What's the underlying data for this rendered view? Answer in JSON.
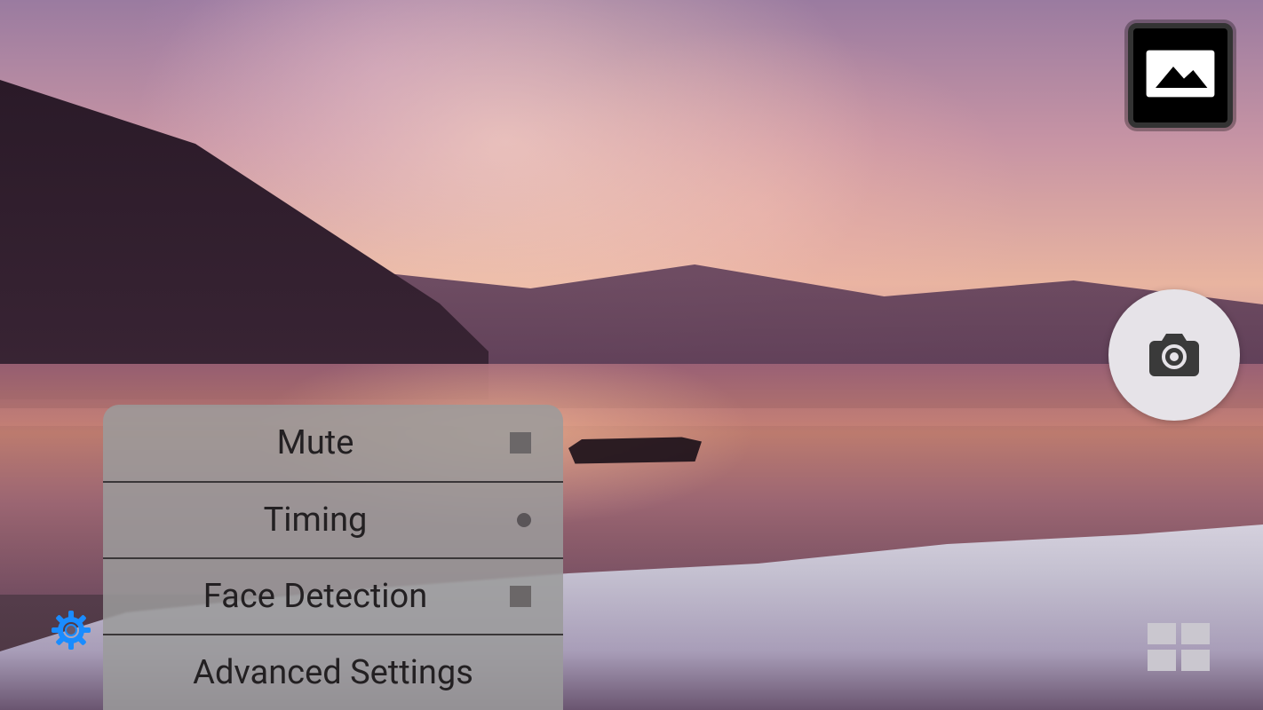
{
  "menu": {
    "items": [
      {
        "label": "Mute",
        "indicator": "square"
      },
      {
        "label": "Timing",
        "indicator": "dot"
      },
      {
        "label": "Face Detection",
        "indicator": "square"
      },
      {
        "label": "Advanced Settings",
        "indicator": "none"
      }
    ]
  },
  "icons": {
    "gallery": "gallery-icon",
    "shutter": "camera-icon",
    "settings": "gear-icon",
    "mode": "grid-icon"
  },
  "colors": {
    "gear_accent": "#1a8cff"
  }
}
